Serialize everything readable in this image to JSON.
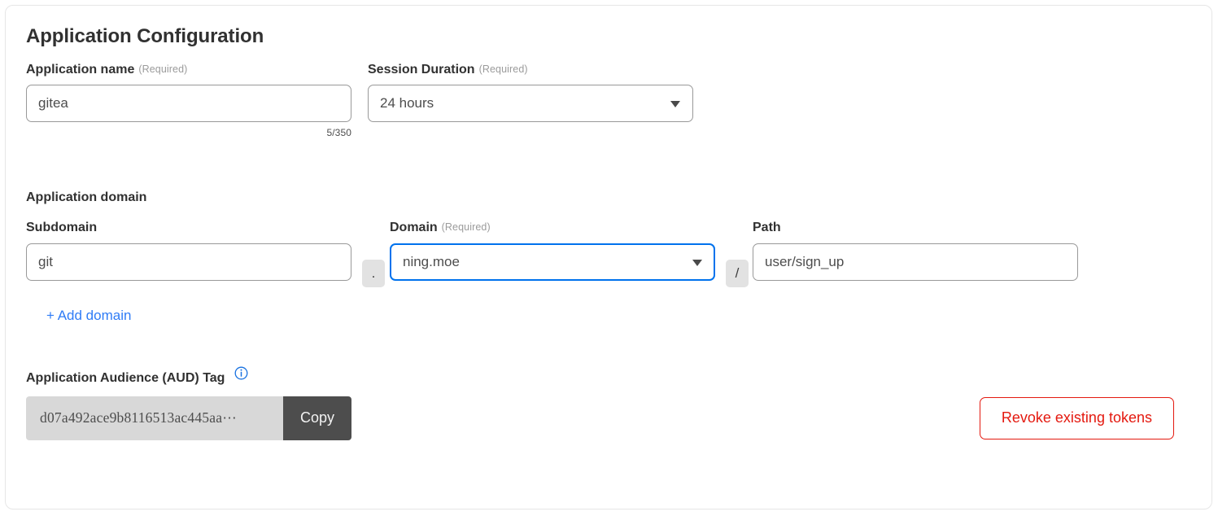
{
  "card": {
    "section_title": "Application Configuration"
  },
  "app_name": {
    "label": "Application name",
    "required_hint": "(Required)",
    "value": "gitea",
    "placeholder": "",
    "counter": "5/350"
  },
  "session_duration": {
    "label": "Session Duration",
    "required_hint": "(Required)",
    "value": "24 hours",
    "caret_icon": "chevron-down-icon"
  },
  "application_domain": {
    "heading": "Application domain",
    "subdomain": {
      "label": "Subdomain",
      "value": "git",
      "placeholder": ""
    },
    "dot_separator": ".",
    "domain": {
      "label": "Domain",
      "required_hint": "(Required)",
      "value": "ning.moe",
      "caret_icon": "chevron-down-icon"
    },
    "slash_separator": "/",
    "path": {
      "label": "Path",
      "value": "user/sign_up",
      "placeholder": ""
    },
    "add_domain_link": "+ Add domain"
  },
  "aud_tag": {
    "label": "Application Audience (AUD) Tag",
    "info_icon": "info-circle-icon",
    "value": "d07a492ace9b8116513ac445aa⋯",
    "copy_label": "Copy"
  },
  "revoke": {
    "label": "Revoke existing tokens"
  },
  "colors": {
    "accent_blue": "#2f7cf6",
    "focus_blue": "#0072ed",
    "danger_red": "#e4190f",
    "text_dark": "#313131",
    "text_body": "#4d4d4d",
    "hint_gray": "#9b9b9b",
    "chip_gray": "#e2e2e2",
    "aud_bg": "#d8d8d8",
    "copy_bg": "#4d4d4d"
  }
}
